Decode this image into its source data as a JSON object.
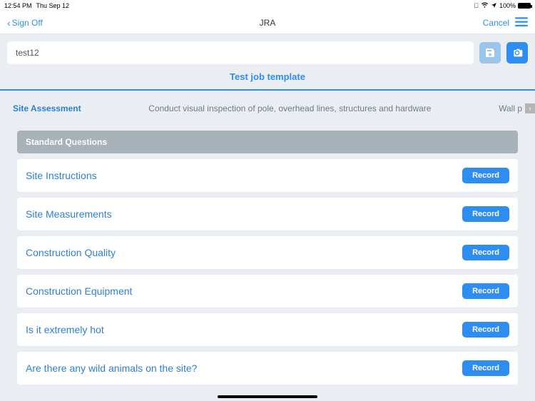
{
  "status": {
    "time": "12:54 PM",
    "date": "Thu Sep 12",
    "batteryPct": "100%"
  },
  "nav": {
    "back": "Sign Off",
    "title": "JRA",
    "cancel": "Cancel"
  },
  "titleRow": {
    "value": "test12"
  },
  "templateName": "Test job template",
  "tabs": {
    "items": [
      {
        "label": "Site Assessment",
        "active": true
      },
      {
        "label": "Conduct visual inspection of pole, overhead lines, structures and hardware",
        "active": false
      },
      {
        "label": "Wall p",
        "active": false
      }
    ]
  },
  "sectionHeader": "Standard Questions",
  "recordLabel": "Record",
  "questions": [
    {
      "title": "Site Instructions"
    },
    {
      "title": "Site Measurements"
    },
    {
      "title": "Construction Quality"
    },
    {
      "title": "Construction Equipment"
    },
    {
      "title": "Is it extremely hot"
    },
    {
      "title": "Are there any wild animals on the site?"
    }
  ]
}
